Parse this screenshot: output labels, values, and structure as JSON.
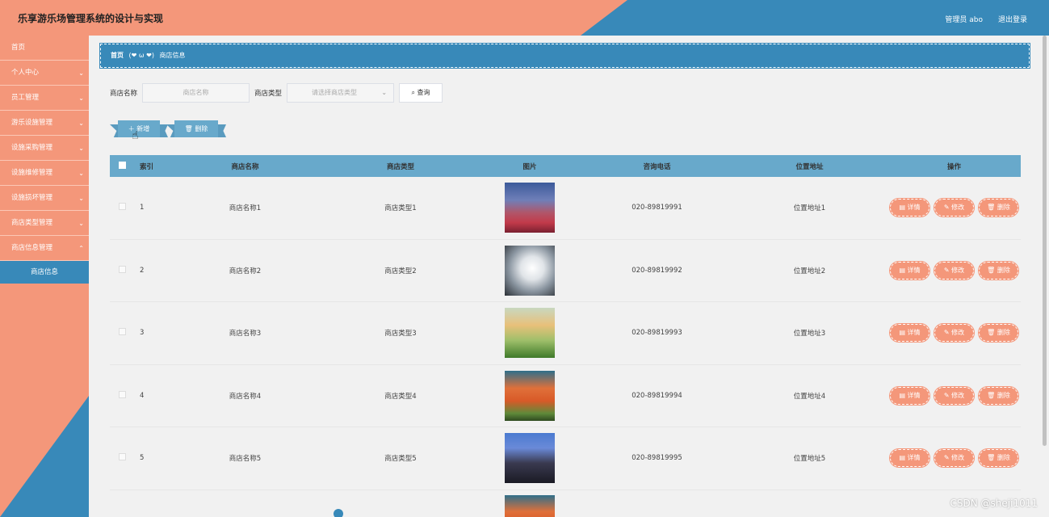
{
  "header": {
    "title": "乐享游乐场管理系统的设计与实现",
    "user": "管理员 abo",
    "logout": "退出登录"
  },
  "sidebar": {
    "items": [
      {
        "label": "首页",
        "chevron": false
      },
      {
        "label": "个人中心",
        "chevron": true
      },
      {
        "label": "员工管理",
        "chevron": true
      },
      {
        "label": "游乐设施管理",
        "chevron": true
      },
      {
        "label": "设施采购管理",
        "chevron": true
      },
      {
        "label": "设施维修管理",
        "chevron": true
      },
      {
        "label": "设施损坏管理",
        "chevron": true
      },
      {
        "label": "商店类型管理",
        "chevron": true
      },
      {
        "label": "商店信息管理",
        "chevron": true
      }
    ],
    "active_sub": "商店信息"
  },
  "breadcrumb": {
    "home": "首页",
    "sep": "(❤ ω ❤)",
    "current": "商店信息"
  },
  "search": {
    "name_label": "商店名称",
    "name_placeholder": "商店名称",
    "type_label": "商店类型",
    "type_placeholder": "请选择商店类型",
    "query_button": "查询"
  },
  "actions": {
    "add": "新增",
    "delete": "删除"
  },
  "table": {
    "columns": [
      "索引",
      "商店名称",
      "商店类型",
      "图片",
      "咨询电话",
      "位置地址",
      "操作"
    ],
    "rows": [
      {
        "index": "1",
        "name": "商店名称1",
        "type": "商店类型1",
        "phone": "020-89819991",
        "address": "位置地址1"
      },
      {
        "index": "2",
        "name": "商店名称2",
        "type": "商店类型2",
        "phone": "020-89819992",
        "address": "位置地址2"
      },
      {
        "index": "3",
        "name": "商店名称3",
        "type": "商店类型3",
        "phone": "020-89819993",
        "address": "位置地址3"
      },
      {
        "index": "4",
        "name": "商店名称4",
        "type": "商店类型4",
        "phone": "020-89819994",
        "address": "位置地址4"
      },
      {
        "index": "5",
        "name": "商店名称5",
        "type": "商店类型5",
        "phone": "020-89819995",
        "address": "位置地址5"
      }
    ],
    "ops": {
      "detail": "详情",
      "edit": "修改",
      "delete": "删除"
    }
  },
  "watermark": "CSDN @sheji1011",
  "colors": {
    "salmon": "#f4977a",
    "blue": "#3889b9",
    "table_header": "#68a9cb"
  }
}
